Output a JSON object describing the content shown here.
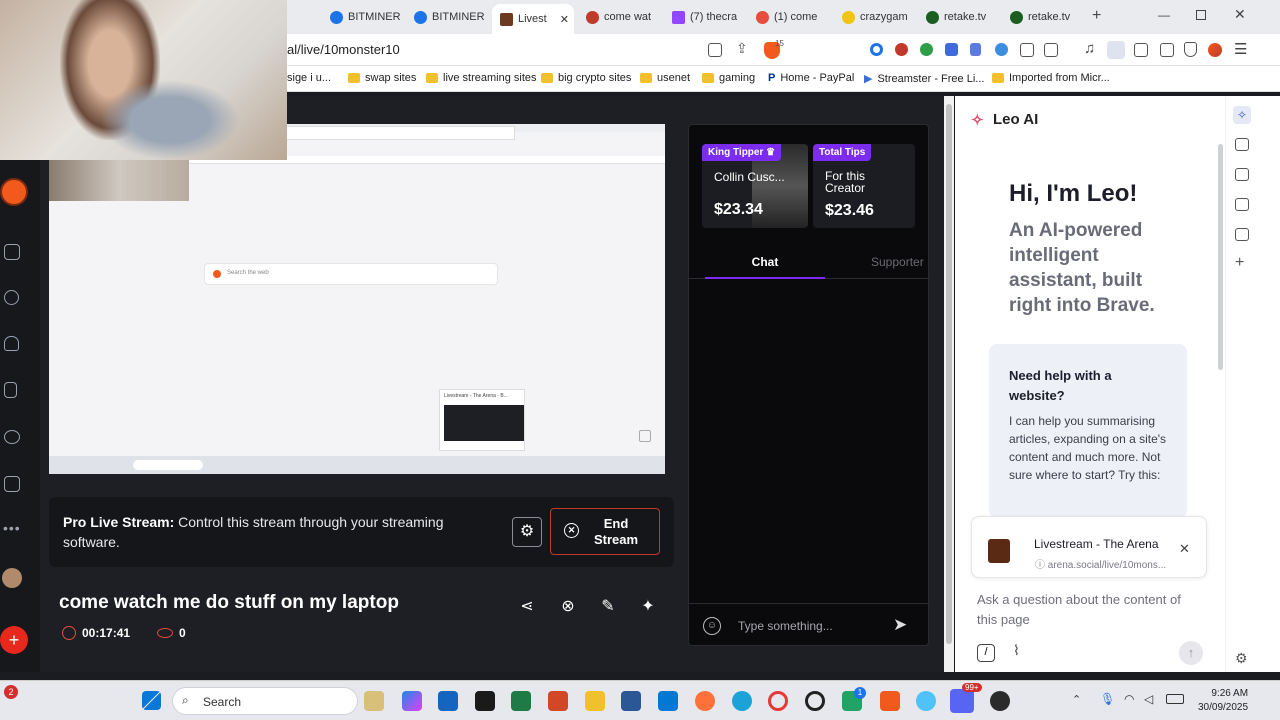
{
  "browser": {
    "tabs": [
      {
        "label": "BITMINER",
        "color": "#1e73e8"
      },
      {
        "label": "BITMINER",
        "color": "#1e73e8"
      },
      {
        "label": "Livest",
        "color": "#6b3a1f",
        "active": true
      },
      {
        "label": "come wat",
        "color": "#c0392b"
      },
      {
        "label": "(7) thecra",
        "color": "#9146ff"
      },
      {
        "label": "(1) come",
        "color": "#e74c3c"
      },
      {
        "label": "crazygam",
        "color": "#1f1f1f"
      },
      {
        "label": "retake.tv",
        "color": "#1b5e20"
      },
      {
        "label": "retake.tv",
        "color": "#1b5e20"
      }
    ],
    "url": "al/live/10monster10",
    "shield_count": "15",
    "bookmarks": [
      "sige i u...",
      "swap sites",
      "live streaming sites",
      "big crypto sites",
      "usenet",
      "gaming",
      "Home - PayPal",
      "Streamster - Free Li...",
      "Imported from Micr..."
    ]
  },
  "stream": {
    "preview_search_placeholder": "Search the web",
    "preview_popup_title": "Livestream - The Arena - B...",
    "pro_label": "Pro Live Stream:",
    "pro_text": "Control this stream through your streaming software.",
    "end_stream_label": "End Stream",
    "title": "come watch me do stuff on my laptop",
    "elapsed": "00:17:41",
    "viewers": "0"
  },
  "chat": {
    "king_tipper_tag": "King Tipper",
    "king_tipper_name": "Collin Cusc...",
    "king_tipper_amount": "$23.34",
    "total_tips_tag": "Total Tips",
    "total_tips_caption": "For this Creator",
    "total_tips_amount": "$23.46",
    "tab_chat": "Chat",
    "tab_supporters": "Supporter",
    "input_placeholder": "Type something..."
  },
  "leo": {
    "header": "Leo AI",
    "greeting": "Hi, I'm Leo!",
    "tagline": "An AI-powered intelligent assistant, built right into Brave.",
    "help_title": "Need help with a website?",
    "help_body": "I can help you summarising articles, expanding on a site's content and much more. Not sure where to start? Try this:",
    "context_title": "Livestream - The Arena",
    "context_url": "arena.social/live/10mons...",
    "ask_placeholder": "Ask a question about the content of this page"
  },
  "taskbar": {
    "search_label": "Search",
    "time": "9:26 AM",
    "date": "30/09/2025",
    "notification_count": "2",
    "discord_badge": "99+",
    "app_badge": "1"
  },
  "colors": {
    "accent_purple": "#7b2cf0",
    "end_stream_red": "#c0392b",
    "orange": "#f25a1d"
  }
}
